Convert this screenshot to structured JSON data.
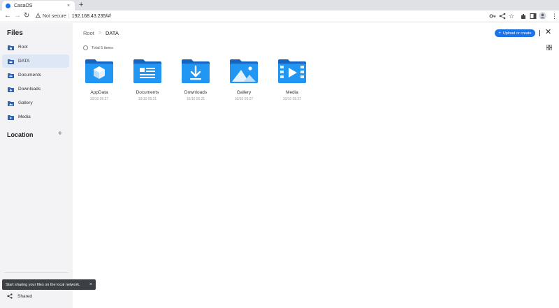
{
  "browser": {
    "tab_title": "CasaOS",
    "tab_close": "×",
    "new_tab": "+",
    "security_label": "Not secure",
    "separator": "|",
    "url": "192.168.43.235/#/"
  },
  "sidebar": {
    "title": "Files",
    "items": [
      {
        "label": "Root",
        "icon": "home-folder-icon"
      },
      {
        "label": "DATA",
        "icon": "drive-folder-icon"
      },
      {
        "label": "Documents",
        "icon": "documents-folder-icon"
      },
      {
        "label": "Downloads",
        "icon": "downloads-folder-icon"
      },
      {
        "label": "Gallery",
        "icon": "gallery-folder-icon"
      },
      {
        "label": "Media",
        "icon": "media-folder-icon"
      }
    ],
    "active_item": "DATA",
    "location_title": "Location",
    "location_add": "+",
    "toast_text": "Start sharing your files on the local network.",
    "toast_close": "×",
    "shared_label": "Shared"
  },
  "main": {
    "breadcrumb": [
      "Root",
      "DATA"
    ],
    "breadcrumb_separator": ">",
    "upload_button": "Upload or create",
    "upload_plus": "+",
    "close": "✕",
    "total_items": "Total 5 items",
    "files": [
      {
        "name": "AppData",
        "date": "10/10 05:27",
        "icon": "appdata-folder-icon"
      },
      {
        "name": "Documents",
        "date": "10/10 05:21",
        "icon": "documents-folder-icon"
      },
      {
        "name": "Downloads",
        "date": "10/10 05:21",
        "icon": "downloads-folder-icon"
      },
      {
        "name": "Gallery",
        "date": "10/10 05:27",
        "icon": "gallery-folder-icon"
      },
      {
        "name": "Media",
        "date": "10/10 05:27",
        "icon": "media-folder-icon"
      }
    ]
  },
  "colors": {
    "accent": "#1a73e8",
    "folder_back": "#1565c0",
    "folder_front": "#2196f3",
    "sidebar_bg": "#f3f3f5",
    "active_item_bg": "#dde7f6"
  }
}
